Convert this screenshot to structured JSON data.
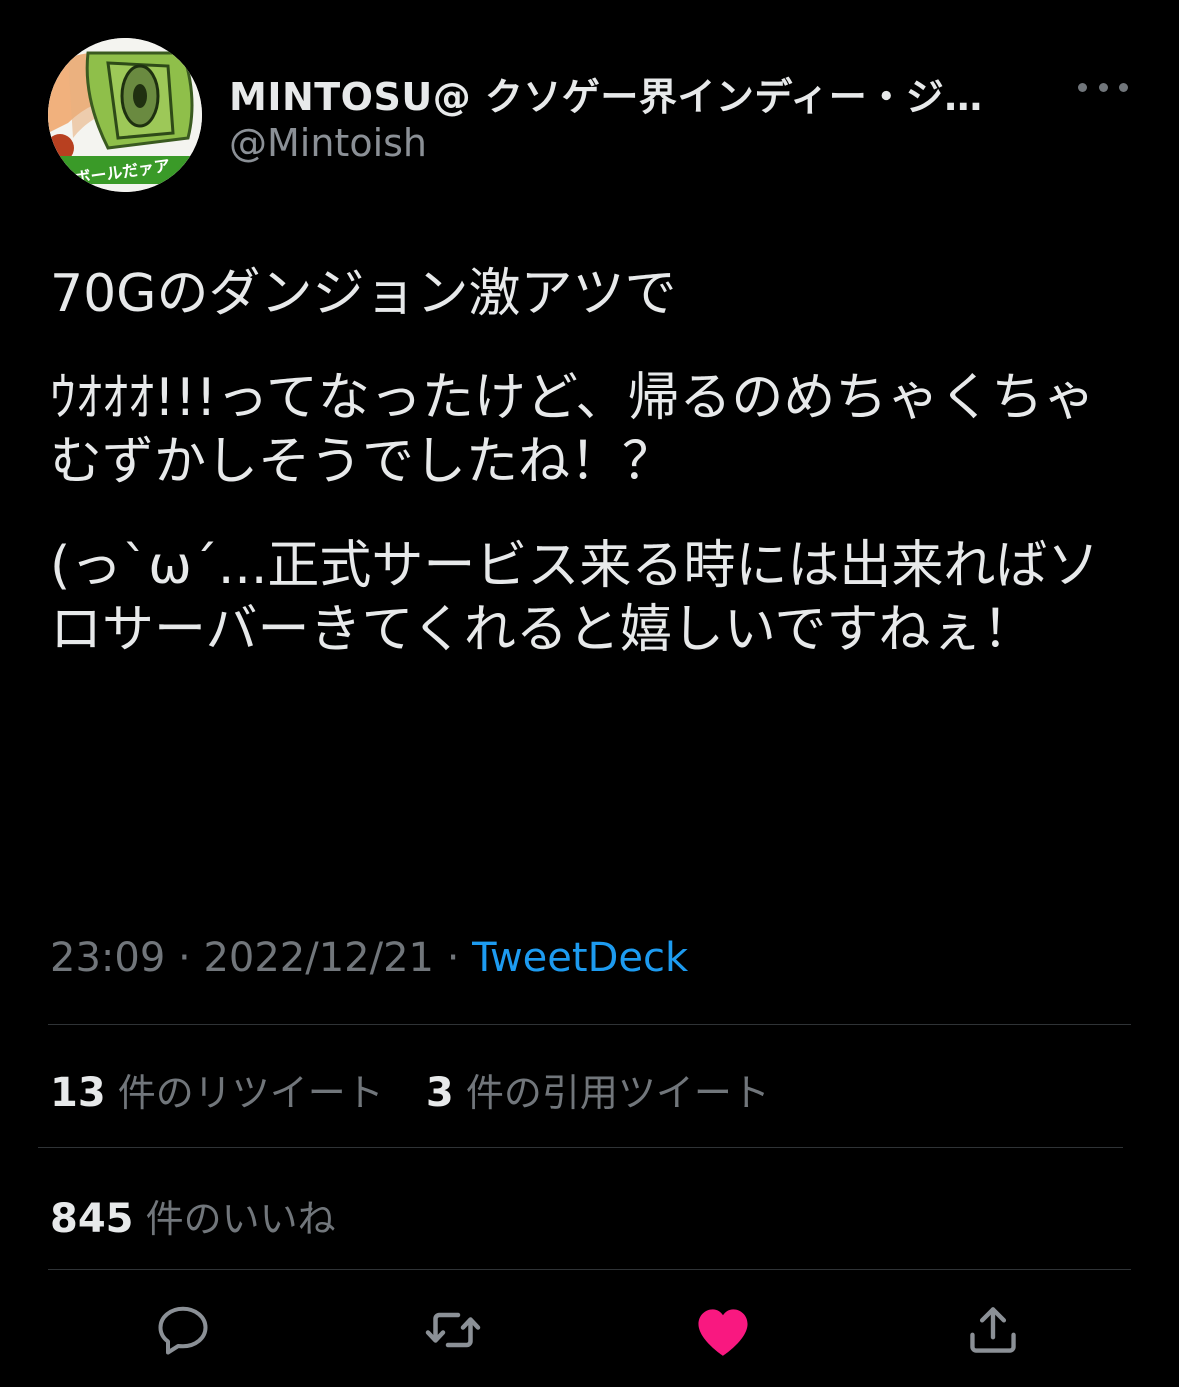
{
  "author": {
    "display_name": "MINTOSU@ クソゲー界インディー・ジ…",
    "handle": "@Mintoish",
    "avatar_text": "ガボールだァア"
  },
  "tweet": {
    "line1": "70Gのダンジョン激アツで",
    "line2": "ｳｵｵｵ!!!ってなったけど、帰るのめちゃくちゃむずかしそうでしたね！？",
    "line3": "(っ`ω´...正式サービス来る時には出来ればソロサーバーきてくれると嬉しいですねぇ！"
  },
  "meta": {
    "time": "23:09",
    "sep1": "·",
    "date": "2022/12/21",
    "sep2": "·",
    "source": "TweetDeck"
  },
  "stats": {
    "retweets_count": "13",
    "retweets_label": "件のリツイート",
    "quotes_count": "3",
    "quotes_label": "件の引用ツイート",
    "likes_count": "845",
    "likes_label": "件のいいね"
  },
  "colors": {
    "accent": "#1d9bf0",
    "like": "#f91880",
    "background": "#000000"
  },
  "icons": {
    "more": "more-horizontal-icon",
    "reply": "reply-icon",
    "retweet": "retweet-icon",
    "like": "heart-filled-icon",
    "share": "share-icon"
  }
}
